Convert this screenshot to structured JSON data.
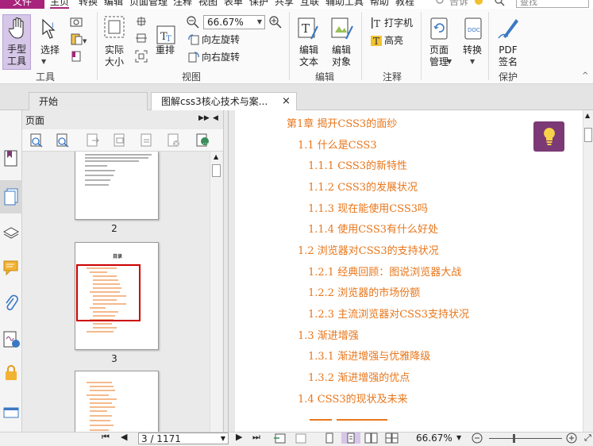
{
  "menu": {
    "file": "文件",
    "items": [
      "主页",
      "转换",
      "编辑",
      "页面管理",
      "注释",
      "视图",
      "表单",
      "保护",
      "共享",
      "互联",
      "辅助工具",
      "帮助",
      "教程"
    ],
    "tell": "告诉",
    "search_placeholder": "查找"
  },
  "ribbon": {
    "hand_tool": "手型\n工具",
    "select": "选择",
    "actual_size": "实际\n大小",
    "reflow": "重排",
    "zoom_value": "66.67%",
    "rotate_left": "向左旋转",
    "rotate_right": "向右旋转",
    "edit_text": "编辑\n文本",
    "edit_object": "编辑\n对象",
    "typewriter": "打字机",
    "highlight": "高亮",
    "page_manage": "页面\n管理",
    "convert": "转换",
    "pdf_sign": "PDF\n签名",
    "groups": {
      "tools": "工具",
      "view": "视图",
      "edit": "编辑",
      "comment": "注释",
      "protect": "保护"
    }
  },
  "tabs": {
    "start": "开始",
    "document": "图解css3核心技术与案...",
    "close": "×"
  },
  "panel": {
    "title": "页面",
    "pages": [
      {
        "label": "2"
      },
      {
        "label": "3"
      }
    ],
    "thumb3_title": "目录"
  },
  "toc": [
    {
      "text": "第1章 揭开CSS3的面纱",
      "level": 0
    },
    {
      "text": "1.1 什么是CSS3",
      "level": 1
    },
    {
      "text": "1.1.1 CSS3的新特性",
      "level": 2
    },
    {
      "text": "1.1.2 CSS3的发展状况",
      "level": 2
    },
    {
      "text": "1.1.3 现在能使用CSS3吗",
      "level": 2
    },
    {
      "text": "1.1.4 使用CSS3有什么好处",
      "level": 2
    },
    {
      "text": "1.2 浏览器对CSS3的支持状况",
      "level": 1
    },
    {
      "text": "1.2.1 经典回顾：图说浏览器大战",
      "level": 2
    },
    {
      "text": "1.2.2 浏览器的市场份额",
      "level": 2
    },
    {
      "text": "1.2.3 主流浏览器对CSS3支持状况",
      "level": 2
    },
    {
      "text": "1.3 渐进增强",
      "level": 1
    },
    {
      "text": "1.3.1 渐进增强与优雅降级",
      "level": 2
    },
    {
      "text": "1.3.2 渐进增强的优点",
      "level": 2
    },
    {
      "text": "1.4 CSS3的现状及未来",
      "level": 1
    }
  ],
  "status": {
    "page_indicator": "3 / 1171",
    "zoom": "66.67%"
  },
  "colors": {
    "accent": "#a8247c",
    "toc": "#e8761b",
    "bulb_bg": "#7b3a75",
    "selection": "#cc0000"
  }
}
